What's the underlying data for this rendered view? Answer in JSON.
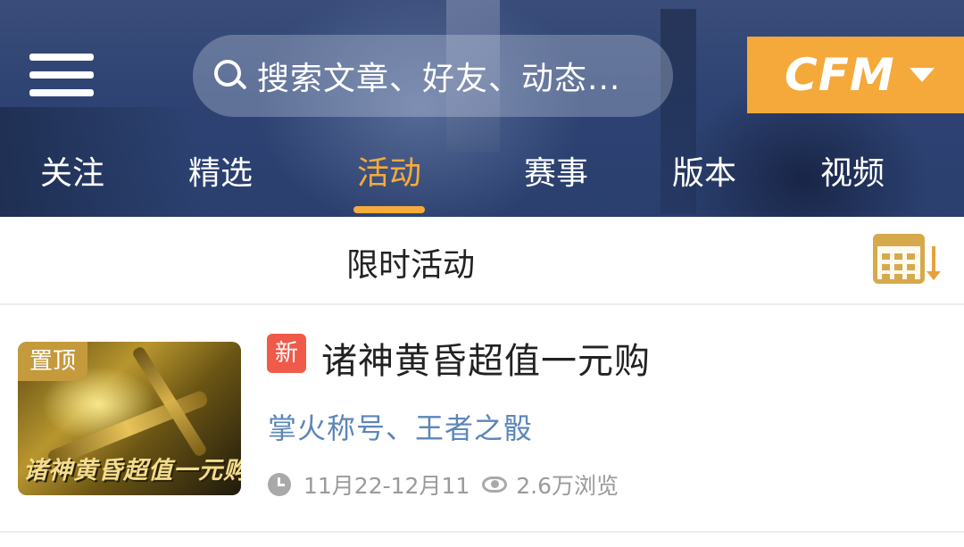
{
  "header": {
    "search": {
      "placeholder": "搜索文章、好友、动态..."
    },
    "game_switch": {
      "label": "CFM"
    }
  },
  "tabs": [
    {
      "label": "关注",
      "active": false
    },
    {
      "label": "精选",
      "active": false
    },
    {
      "label": "活动",
      "active": true
    },
    {
      "label": "赛事",
      "active": false
    },
    {
      "label": "版本",
      "active": false
    },
    {
      "label": "视频",
      "active": false
    }
  ],
  "section": {
    "title": "限时活动"
  },
  "items": [
    {
      "pin_label": "置顶",
      "thumbnail_caption": "诸神黄昏超值一元购",
      "new_label": "新",
      "title": "诸神黄昏超值一元购",
      "subtitle": "掌火称号、王者之骰",
      "date_range": "11月22-12月11",
      "views": "2.6万浏览"
    }
  ],
  "colors": {
    "accent": "#f7ab3a",
    "header_bg": "#2e4373",
    "new_badge": "#ef5a4a",
    "subtitle": "#5b86b8",
    "meta_text": "#9a9a9a"
  },
  "icons": [
    "menu-icon",
    "search-icon",
    "chevron-down-icon",
    "calendar-icon",
    "sort-arrow-icon",
    "clock-icon",
    "eye-icon"
  ]
}
